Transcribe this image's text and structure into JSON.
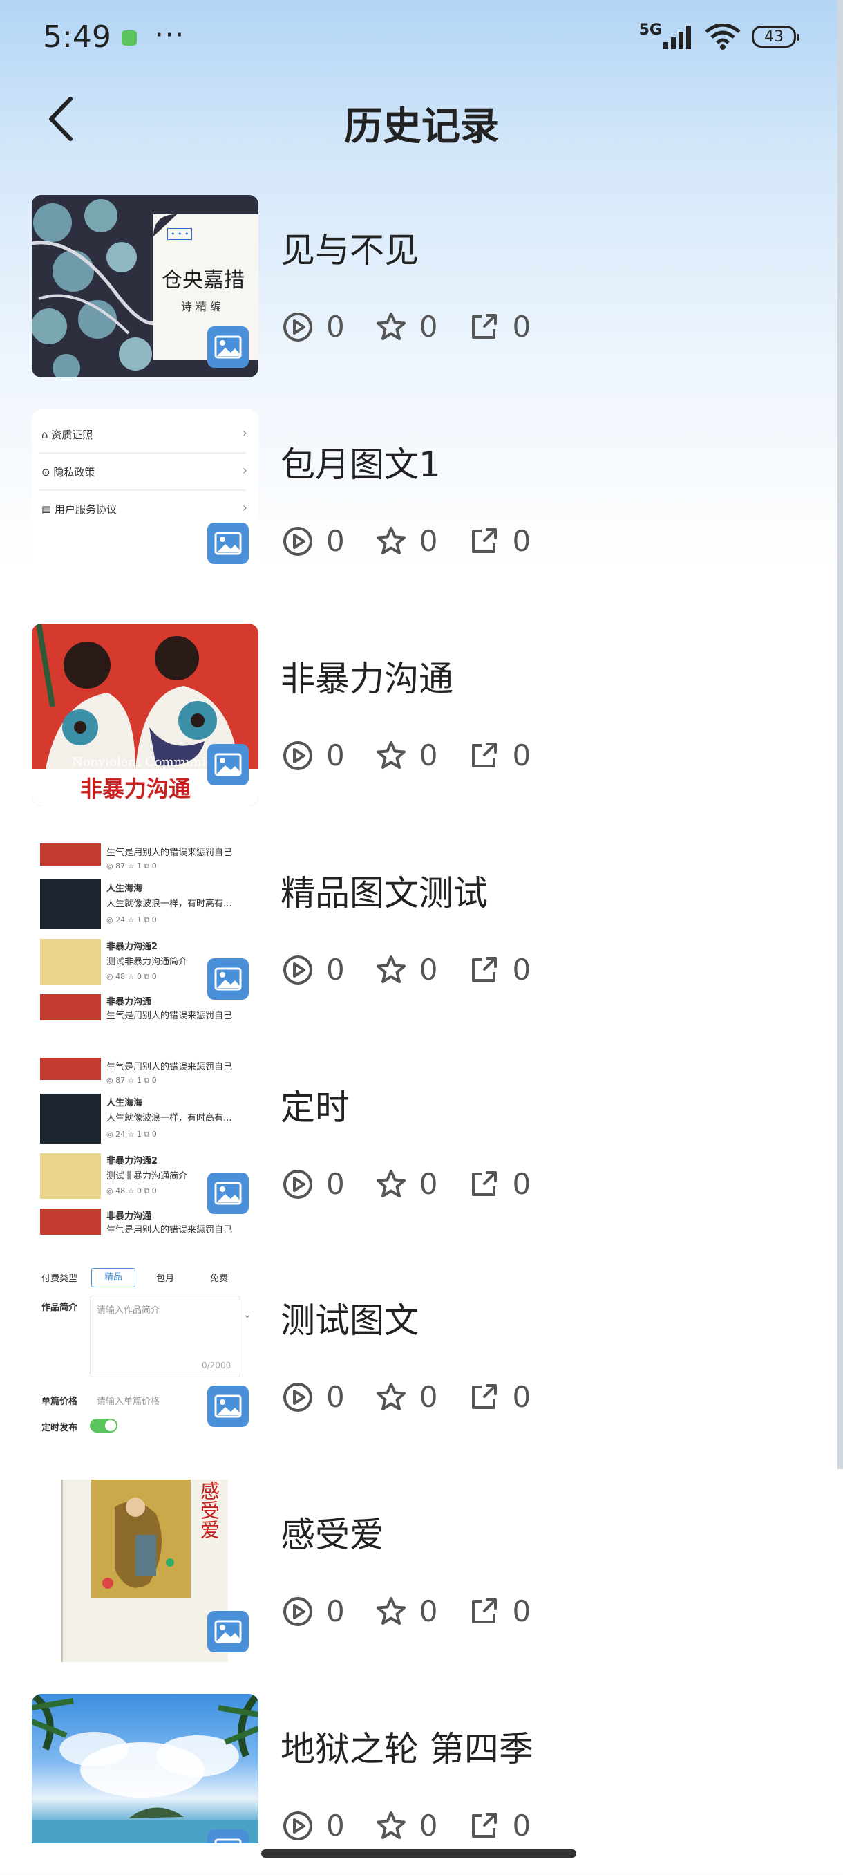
{
  "status": {
    "time": "5:49",
    "more": "···",
    "network": "5G",
    "battery": "43"
  },
  "header": {
    "title": "历史记录"
  },
  "colors": {
    "badge": "#4a90d9",
    "icon_gray": "#555555"
  },
  "items": [
    {
      "title": "见与不见",
      "plays": "0",
      "stars": "0",
      "shares": "0",
      "cover": {
        "book_title": "仓央嘉措",
        "subtitle": "诗 精 编"
      }
    },
    {
      "title": "包月图文1",
      "plays": "0",
      "stars": "0",
      "shares": "0",
      "cover": {
        "rows": [
          "资质证照",
          "隐私政策",
          "用户服务协议"
        ]
      }
    },
    {
      "title": "非暴力沟通",
      "plays": "0",
      "stars": "0",
      "shares": "0",
      "cover": {
        "english": "Nonviolent Communication",
        "chinese": "非暴力沟通"
      }
    },
    {
      "title": "精品图文测试",
      "plays": "0",
      "stars": "0",
      "shares": "0",
      "cover": {
        "entries": [
          {
            "name": "",
            "desc": "生气是用别人的错误来惩罚自己",
            "meta": "◎ 87  ☆ 1  ⧉ 0"
          },
          {
            "name": "人生海海",
            "desc": "人生就像波浪一样，有时高有...",
            "meta": "◎ 24  ☆ 1  ⧉ 0"
          },
          {
            "name": "非暴力沟通2",
            "desc": "测试非暴力沟通简介",
            "meta": "◎ 48  ☆ 0  ⧉ 0"
          },
          {
            "name": "非暴力沟通",
            "desc": "生气是用别人的错误来惩罚自己",
            "meta": ""
          }
        ]
      }
    },
    {
      "title": "定时",
      "plays": "0",
      "stars": "0",
      "shares": "0",
      "cover": {
        "entries": [
          {
            "name": "",
            "desc": "生气是用别人的错误来惩罚自己",
            "meta": "◎ 87  ☆ 1  ⧉ 0"
          },
          {
            "name": "人生海海",
            "desc": "人生就像波浪一样，有时高有...",
            "meta": "◎ 24  ☆ 1  ⧉ 0"
          },
          {
            "name": "非暴力沟通2",
            "desc": "测试非暴力沟通简介",
            "meta": "◎ 48  ☆ 0  ⧉ 0"
          },
          {
            "name": "非暴力沟通",
            "desc": "生气是用别人的错误来惩罚自己",
            "meta": ""
          }
        ]
      }
    },
    {
      "title": "测试图文",
      "plays": "0",
      "stars": "0",
      "shares": "0",
      "cover": {
        "fee_label": "付费类型",
        "fee_options": [
          "精品",
          "包月",
          "免费"
        ],
        "intro_label": "作品简介",
        "intro_placeholder": "请输入作品简介",
        "counter": "0/2000",
        "price_label": "单篇价格",
        "price_placeholder": "请输入单篇价格",
        "timer_label": "定时发布"
      }
    },
    {
      "title": "感受爱",
      "plays": "0",
      "stars": "0",
      "shares": "0",
      "cover": {
        "book_title": "感受爱"
      }
    },
    {
      "title": "地狱之轮 第四季",
      "plays": "0",
      "stars": "0",
      "shares": "0",
      "cover": {}
    }
  ]
}
